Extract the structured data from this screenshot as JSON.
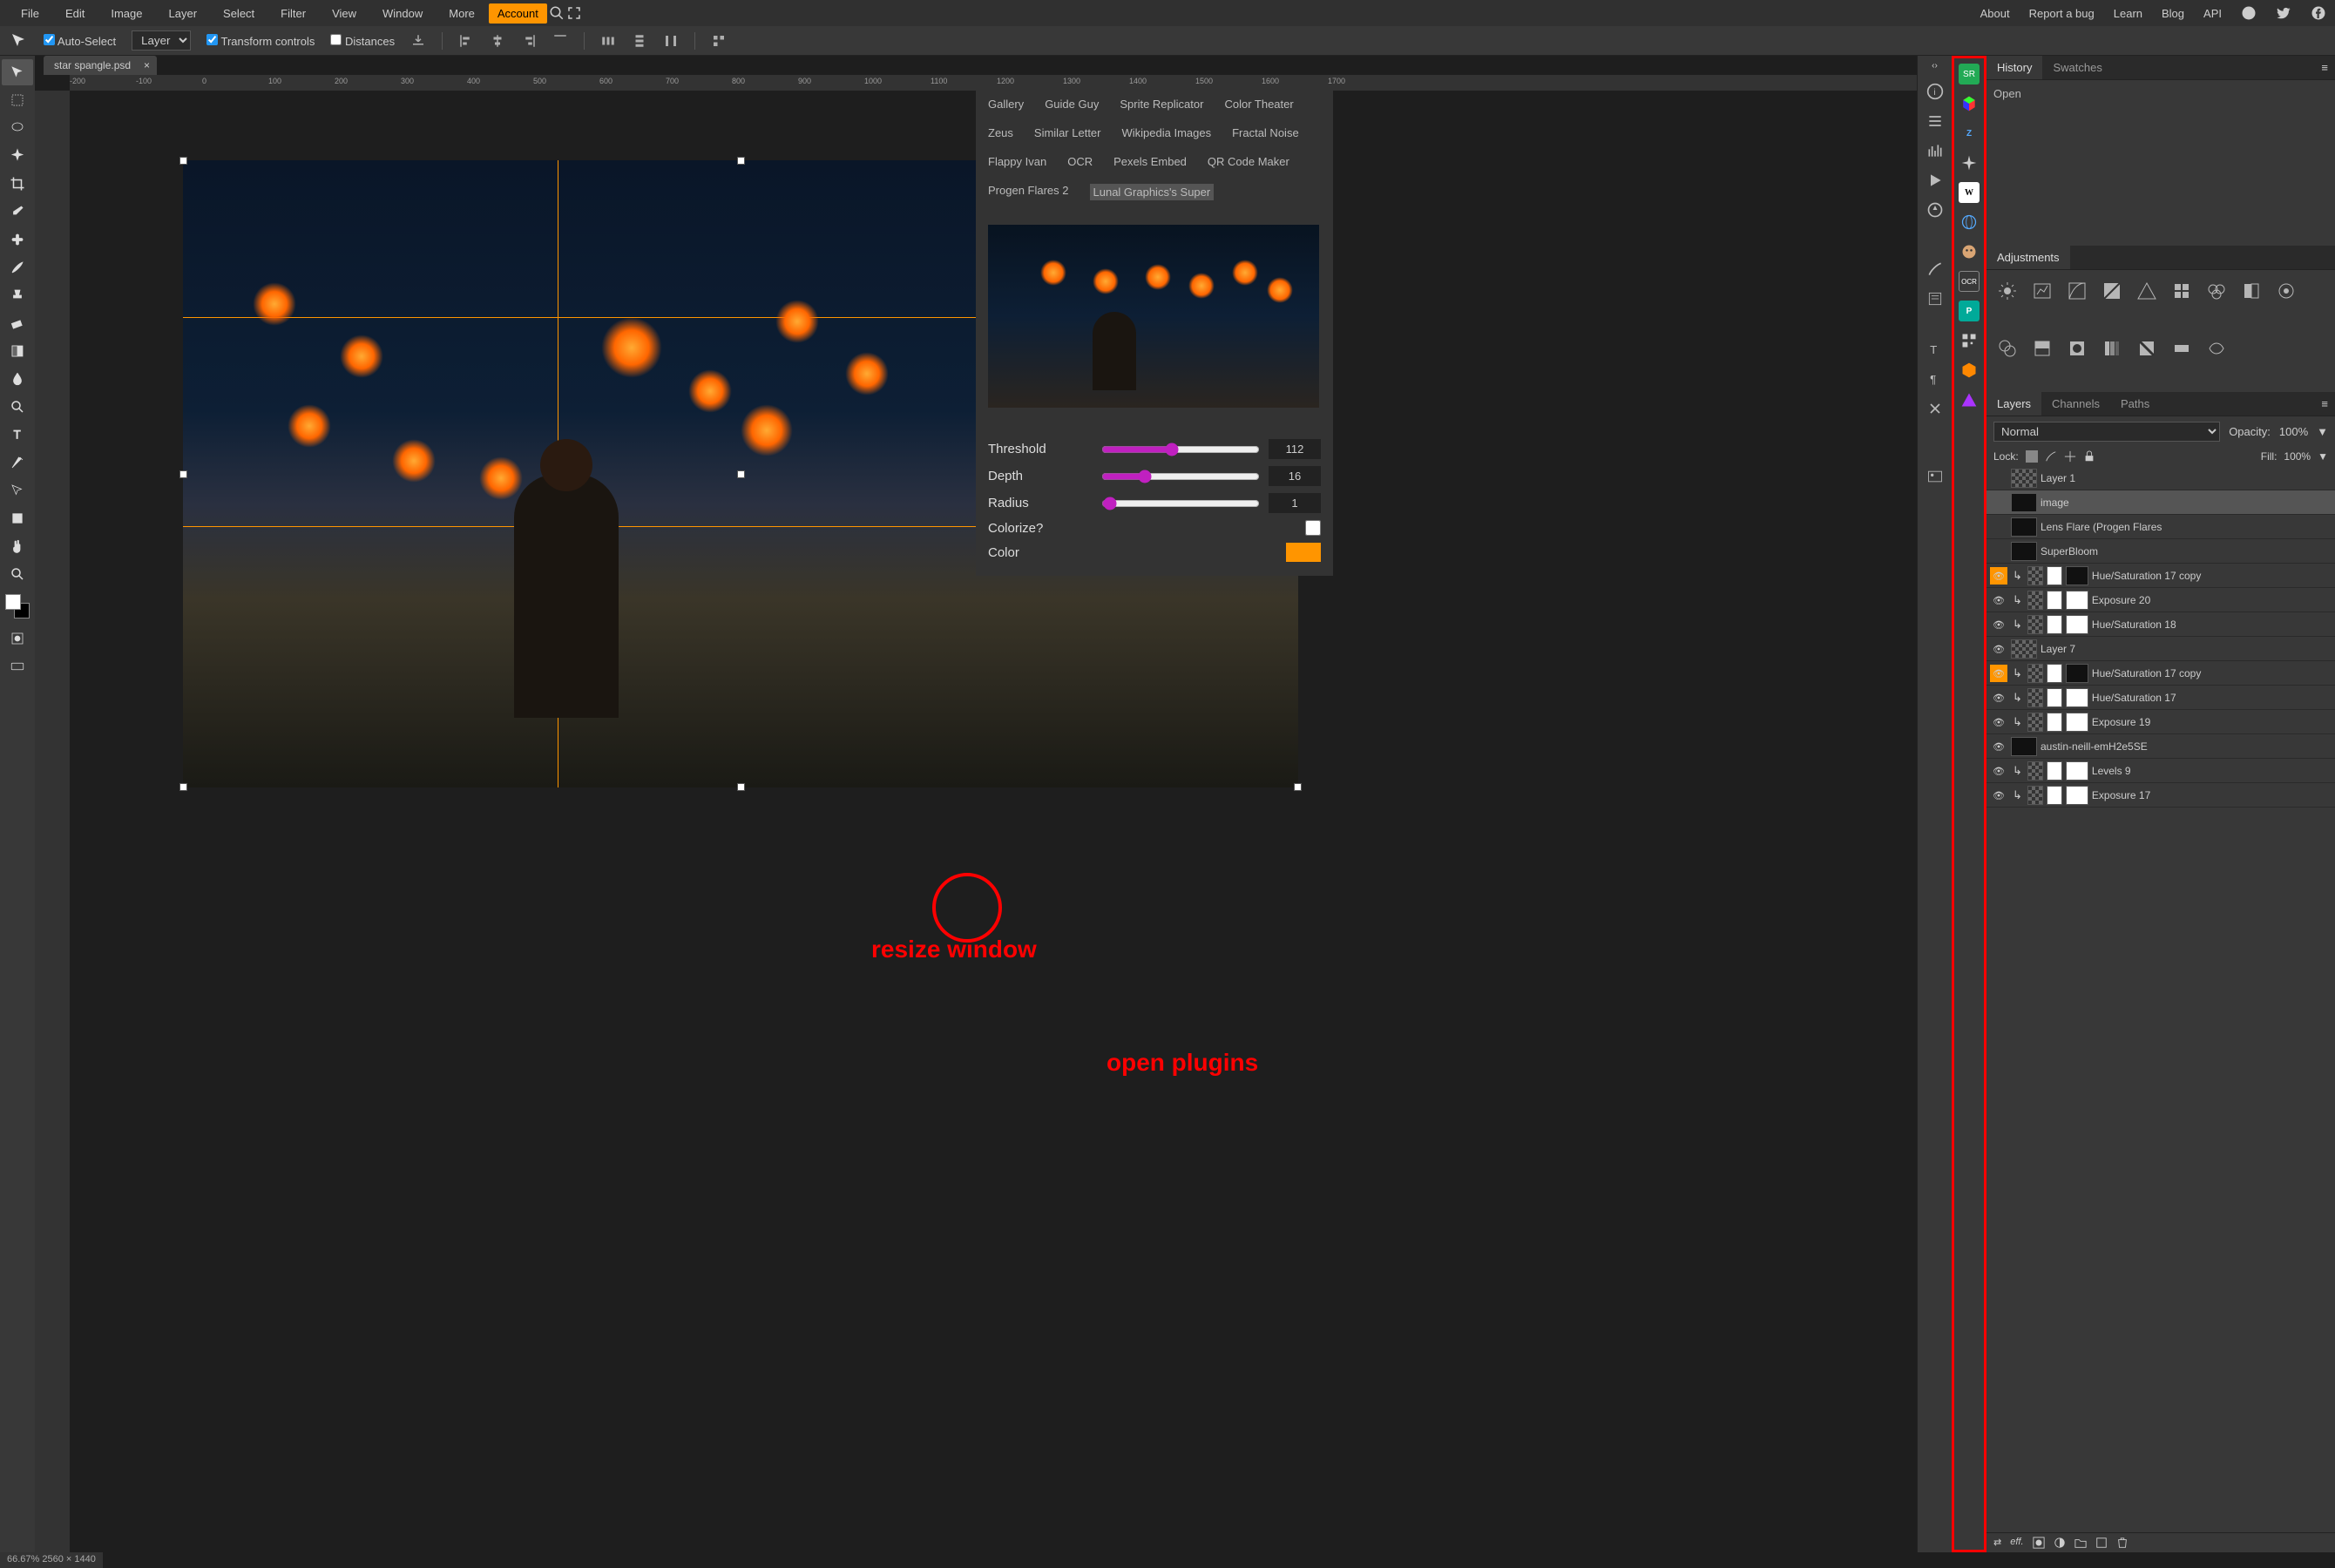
{
  "menubar": {
    "items": [
      "File",
      "Edit",
      "Image",
      "Layer",
      "Select",
      "Filter",
      "View",
      "Window",
      "More"
    ],
    "account": "Account",
    "right": [
      "About",
      "Report a bug",
      "Learn",
      "Blog",
      "API"
    ]
  },
  "optbar": {
    "auto_select": "Auto-Select",
    "layer_label": "Layer",
    "transform": "Transform controls",
    "distances": "Distances"
  },
  "tab": {
    "name": "star spangle.psd"
  },
  "ruler_marks": [
    "-200",
    "-100",
    "0",
    "100",
    "200",
    "300",
    "400",
    "500",
    "600",
    "700",
    "800",
    "900",
    "1000",
    "1100",
    "1200",
    "1300",
    "1400",
    "1500",
    "1600",
    "1700"
  ],
  "plugins": {
    "list": [
      "Gallery",
      "Guide Guy",
      "Sprite Replicator",
      "Color Theater",
      "Zeus",
      "Similar Letter",
      "Wikipedia Images",
      "Fractal Noise",
      "Flappy Ivan",
      "OCR",
      "Pexels Embed",
      "QR Code Maker",
      "Progen Flares 2",
      "Lunal Graphics's Super"
    ],
    "selected": "Lunal Graphics's Super",
    "controls": {
      "threshold": {
        "label": "Threshold",
        "value": "112"
      },
      "depth": {
        "label": "Depth",
        "value": "16"
      },
      "radius": {
        "label": "Radius",
        "value": "1"
      },
      "colorize": {
        "label": "Colorize?"
      },
      "color": {
        "label": "Color"
      }
    }
  },
  "history_panel": {
    "tabs": [
      "History",
      "Swatches"
    ],
    "items": [
      "Open"
    ]
  },
  "adjustments_panel": {
    "title": "Adjustments"
  },
  "layers_panel": {
    "tabs": [
      "Layers",
      "Channels",
      "Paths"
    ],
    "blend": "Normal",
    "opacity_label": "Opacity:",
    "opacity": "100%",
    "lock_label": "Lock:",
    "fill_label": "Fill:",
    "fill": "100%",
    "layers": [
      {
        "name": "Layer 1",
        "vis": false,
        "sel": false,
        "type": "img",
        "thumb": "checker"
      },
      {
        "name": "image",
        "vis": false,
        "sel": true,
        "type": "img",
        "thumb": "dark"
      },
      {
        "name": "Lens Flare (Progen Flares",
        "vis": false,
        "sel": false,
        "type": "img",
        "thumb": "dark"
      },
      {
        "name": "SuperBloom",
        "vis": false,
        "sel": false,
        "type": "img",
        "thumb": "dark"
      },
      {
        "name": "Hue/Saturation 17 copy",
        "vis": true,
        "sel": false,
        "type": "adj",
        "orange": true
      },
      {
        "name": "Exposure 20",
        "vis": true,
        "sel": false,
        "type": "adj"
      },
      {
        "name": "Hue/Saturation 18",
        "vis": true,
        "sel": false,
        "type": "adj"
      },
      {
        "name": "Layer 7",
        "vis": true,
        "sel": false,
        "type": "img",
        "thumb": "checker"
      },
      {
        "name": "Hue/Saturation 17 copy",
        "vis": true,
        "sel": false,
        "type": "adj",
        "orange": true
      },
      {
        "name": "Hue/Saturation 17",
        "vis": true,
        "sel": false,
        "type": "adj"
      },
      {
        "name": "Exposure 19",
        "vis": true,
        "sel": false,
        "type": "adj"
      },
      {
        "name": "austin-neill-emH2e5SE",
        "vis": true,
        "sel": false,
        "type": "img",
        "thumb": "dark"
      },
      {
        "name": "Levels 9",
        "vis": true,
        "sel": false,
        "type": "adj"
      },
      {
        "name": "Exposure 17",
        "vis": true,
        "sel": false,
        "type": "adj"
      }
    ]
  },
  "statusbar": "66.67%  2560 × 1440",
  "annotations": {
    "resize": "resize window",
    "open_plugins": "open plugins"
  }
}
